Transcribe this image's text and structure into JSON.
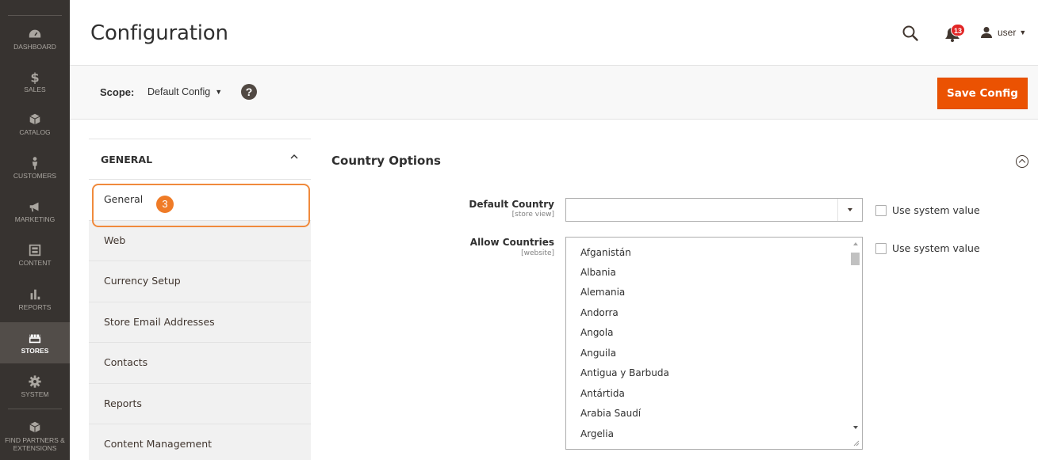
{
  "nav": {
    "items": [
      {
        "label": "DASHBOARD",
        "icon": "dashboard-icon"
      },
      {
        "label": "SALES",
        "icon": "dollar-icon"
      },
      {
        "label": "CATALOG",
        "icon": "box-icon"
      },
      {
        "label": "CUSTOMERS",
        "icon": "person-icon"
      },
      {
        "label": "MARKETING",
        "icon": "megaphone-icon"
      },
      {
        "label": "CONTENT",
        "icon": "layout-icon"
      },
      {
        "label": "REPORTS",
        "icon": "bar-chart-icon"
      },
      {
        "label": "STORES",
        "icon": "storefront-icon"
      },
      {
        "label": "SYSTEM",
        "icon": "gear-icon"
      },
      {
        "label": "FIND PARTNERS & EXTENSIONS",
        "icon": "puzzle-box-icon"
      }
    ],
    "active": "STORES"
  },
  "header": {
    "title": "Configuration",
    "notifications_count": "13",
    "user_name": "user"
  },
  "scope": {
    "label": "Scope:",
    "value": "Default Config",
    "help": "?"
  },
  "actions": {
    "save_label": "Save Config"
  },
  "config_tabs": {
    "group_title": "GENERAL",
    "items": [
      {
        "label": "General"
      },
      {
        "label": "Web"
      },
      {
        "label": "Currency Setup"
      },
      {
        "label": "Store Email Addresses"
      },
      {
        "label": "Contacts"
      },
      {
        "label": "Reports"
      },
      {
        "label": "Content Management"
      }
    ],
    "active": "General",
    "step_badge": "3"
  },
  "section": {
    "title": "Country Options"
  },
  "fields": {
    "default_country": {
      "label": "Default Country",
      "scope": "[store view]",
      "value": "",
      "use_system_value": "Use system value"
    },
    "allow_countries": {
      "label": "Allow Countries",
      "scope": "[website]",
      "options": [
        "Afganistán",
        "Albania",
        "Alemania",
        "Andorra",
        "Angola",
        "Anguila",
        "Antigua y Barbuda",
        "Antártida",
        "Arabia Saudí",
        "Argelia"
      ],
      "use_system_value": "Use system value"
    }
  },
  "colors": {
    "nav_bg": "#373330",
    "nav_active_bg": "#524d49",
    "accent": "#eb5202",
    "highlight": "#f08a3c",
    "badge": "#e22626"
  }
}
